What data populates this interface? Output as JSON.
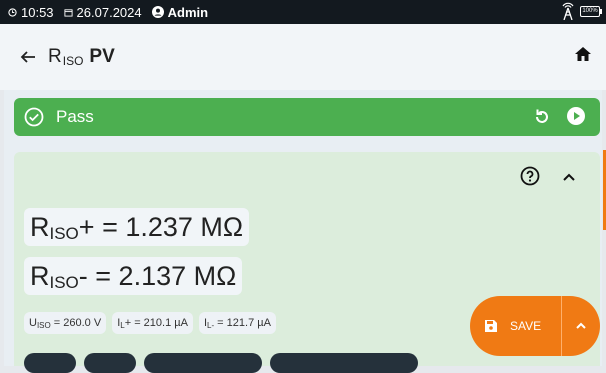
{
  "status": {
    "time": "10:53",
    "date": "26.07.2024",
    "user": "Admin",
    "battery": "100%"
  },
  "header": {
    "title_main": "R",
    "title_sub": "ISO",
    "title_suffix": "PV"
  },
  "result_bar": {
    "label": "Pass",
    "color": "#4caf50"
  },
  "results": {
    "r_plus": {
      "prefix": "R",
      "sub": "ISO",
      "value": "+ = 1.237 MΩ"
    },
    "r_minus": {
      "prefix": "R",
      "sub": "ISO",
      "value": "- = 2.137 MΩ"
    },
    "chips": [
      {
        "prefix": "U",
        "sub": "ISO",
        "value": " = 260.0 V"
      },
      {
        "prefix": "I",
        "sub": "L",
        "value": "+ = 210.1 µA"
      },
      {
        "prefix": "I",
        "sub": "L-",
        "value": " = 121.7 µA"
      }
    ]
  },
  "save_button": {
    "label": "SAVE",
    "color": "#f07a14"
  },
  "icons": {
    "back": "arrow-left-icon",
    "home": "home-icon",
    "check": "check-circle-icon",
    "retry": "retry-icon",
    "play": "play-circle-icon",
    "help": "help-circle-icon",
    "collapse": "chevron-up-icon",
    "save": "floppy-disk-icon",
    "expand": "chevron-up-icon"
  }
}
